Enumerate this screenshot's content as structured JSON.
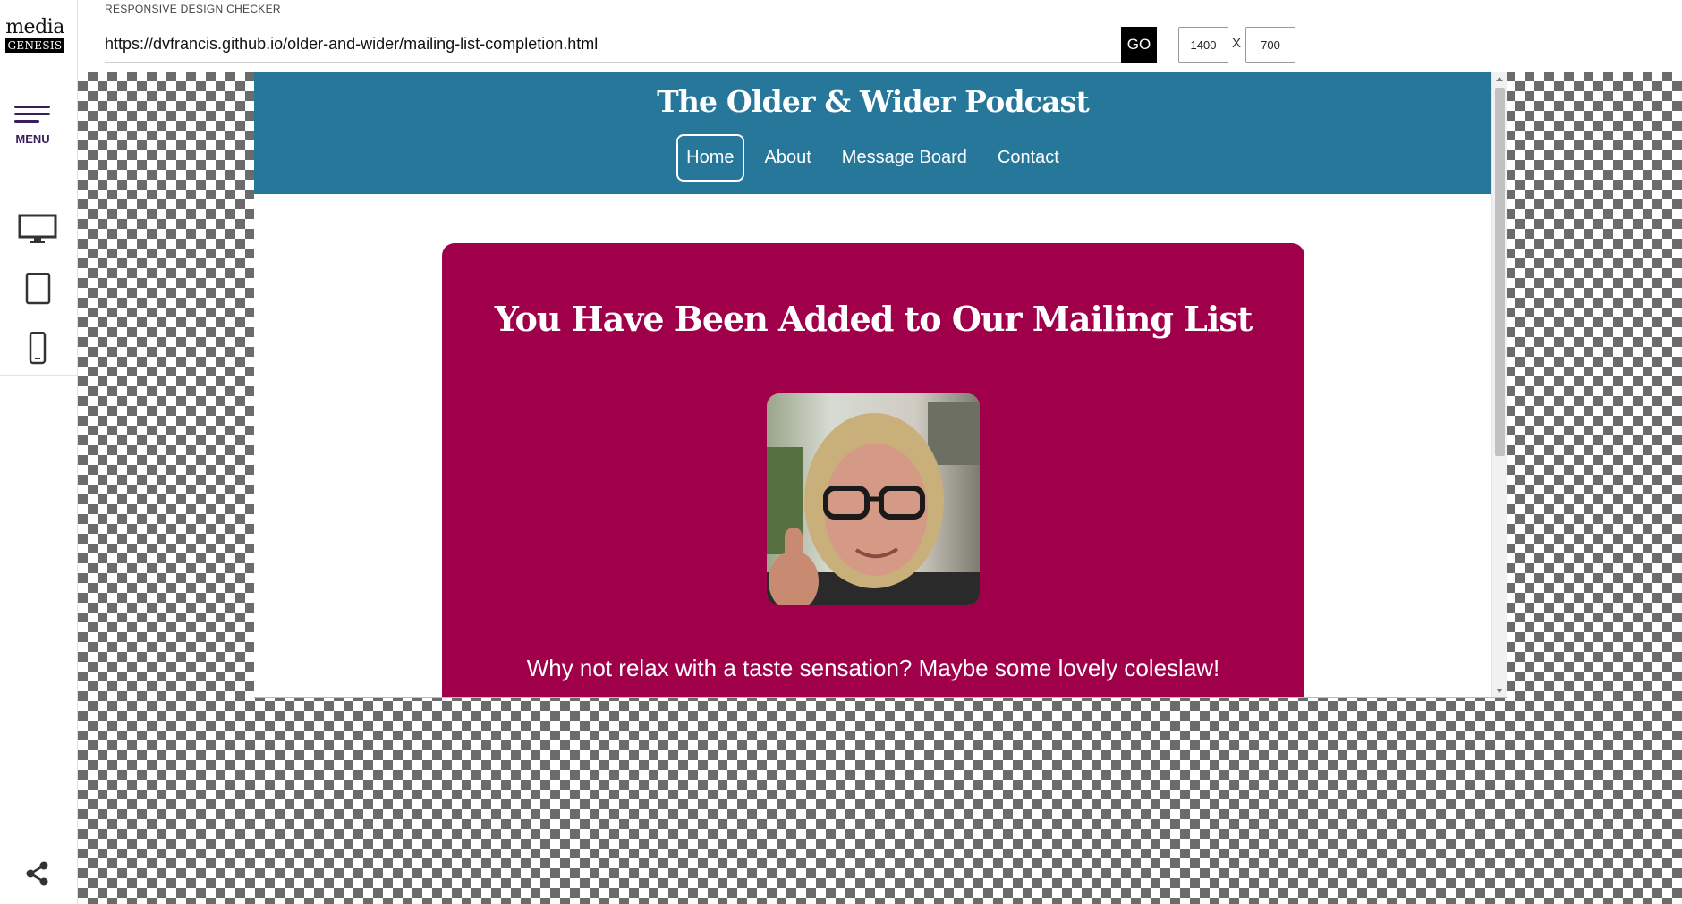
{
  "app": {
    "title": "RESPONSIVE DESIGN CHECKER",
    "logo_top": "media",
    "logo_bottom": "GENESIS"
  },
  "sidebar": {
    "menu_label": "MENU",
    "devices": [
      {
        "name": "desktop",
        "icon": "desktop-icon"
      },
      {
        "name": "tablet",
        "icon": "tablet-icon"
      },
      {
        "name": "phone",
        "icon": "phone-icon"
      }
    ],
    "share_icon": "share-icon"
  },
  "toolbar": {
    "url": "https://dvfrancis.github.io/older-and-wider/mailing-list-completion.html",
    "go_label": "GO",
    "width": "1400",
    "separator": "X",
    "height": "700"
  },
  "site": {
    "title": "The Older & Wider Podcast",
    "nav": [
      "Home",
      "About",
      "Message Board",
      "Contact"
    ],
    "active_nav": "Home",
    "card_heading": "You Have Been Added to Our Mailing List",
    "card_text": "Why not relax with a taste sensation? Maybe some lovely coleslaw!"
  },
  "colors": {
    "header_bg": "#26779a",
    "card_bg": "#a0004a",
    "menu_accent": "#3a1e5c"
  }
}
